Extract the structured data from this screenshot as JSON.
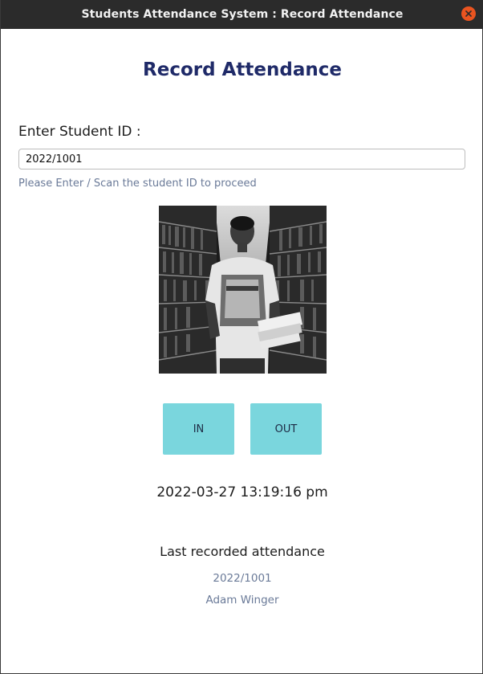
{
  "window": {
    "title": "Students Attendance System : Record Attendance"
  },
  "page": {
    "heading": "Record Attendance",
    "field_label": "Enter Student ID :",
    "student_id_value": "2022/1001",
    "helper_text": "Please Enter / Scan the student ID to proceed",
    "photo_icon": "student-photo",
    "in_label": "IN",
    "out_label": "OUT",
    "datetime": "2022-03-27 13:19:16 pm",
    "last_title": "Last recorded attendance",
    "last_id": "2022/1001",
    "last_name": "Adam Winger"
  },
  "colors": {
    "heading": "#1f2a68",
    "button_bg": "#7ad6dd",
    "helper_text": "#6a7a98",
    "close_button": "#e95420"
  }
}
